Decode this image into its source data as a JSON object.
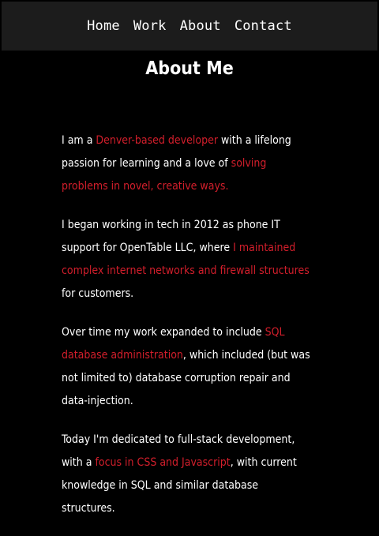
{
  "nav": {
    "items": [
      {
        "label": "Home"
      },
      {
        "label": "Work"
      },
      {
        "label": "About"
      },
      {
        "label": "Contact"
      }
    ]
  },
  "page": {
    "title": "About Me"
  },
  "about": {
    "p1": {
      "a": "I am a ",
      "b": "Denver-based developer",
      "c": " with a lifelong passion for learning and a love of ",
      "d": "solving problems in novel, creative ways."
    },
    "p2": {
      "a": "I began working in tech in 2012 as phone IT support for OpenTable LLC, where ",
      "b": "I maintained complex internet networks and firewall structures",
      "c": " for customers."
    },
    "p3": {
      "a": "Over time my work expanded to include ",
      "b": "SQL database administration",
      "c": ", which included (but was not limited to) database corruption repair and data-injection."
    },
    "p4": {
      "a": "Today I'm dedicated to full-stack development, with a ",
      "b": "focus in CSS and Javascript",
      "c": ", with current knowledge in SQL and similar database structures."
    }
  },
  "colors": {
    "background": "#000000",
    "navbar": "#1c1c1c",
    "text": "#ffffff",
    "accent": "#d21e2b"
  }
}
